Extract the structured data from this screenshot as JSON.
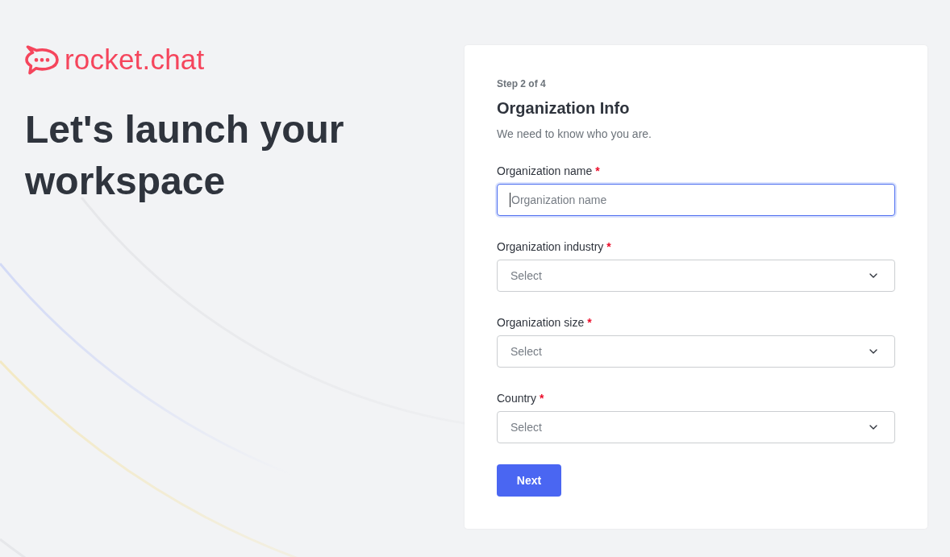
{
  "brand": {
    "name": "rocket.chat"
  },
  "headline": "Let's launch your workspace",
  "form": {
    "step": "Step 2 of 4",
    "title": "Organization Info",
    "subtitle": "We need to know who you are.",
    "fields": [
      {
        "kind": "text",
        "label": "Organization name",
        "required_mark": "*",
        "placeholder": "Organization name",
        "focused": true
      },
      {
        "kind": "select",
        "label": "Organization industry",
        "required_mark": "*",
        "placeholder": "Select",
        "focused": false
      },
      {
        "kind": "select",
        "label": "Organization size",
        "required_mark": "*",
        "placeholder": "Select",
        "focused": false
      },
      {
        "kind": "select",
        "label": "Country",
        "required_mark": "*",
        "placeholder": "Select",
        "focused": false
      }
    ],
    "submit": {
      "label": "Next"
    }
  }
}
